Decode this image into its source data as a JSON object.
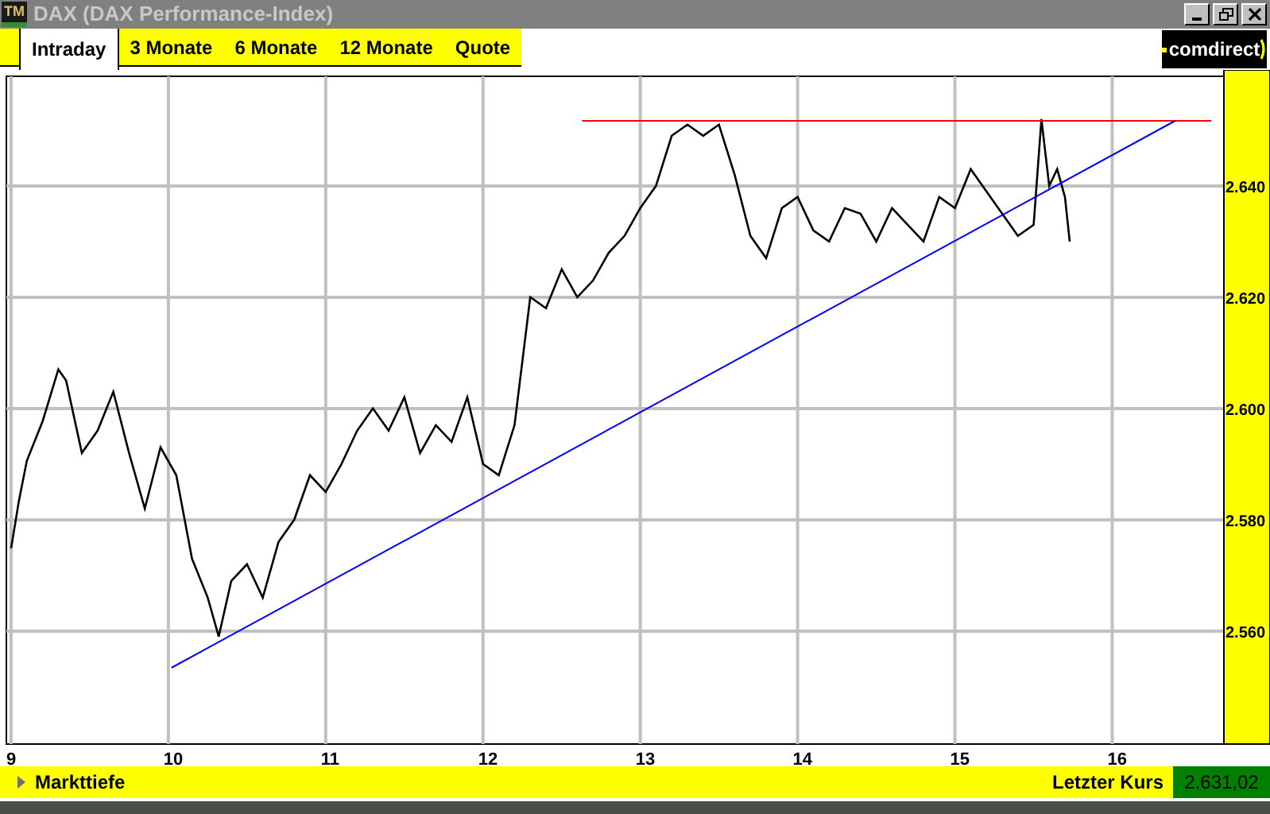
{
  "window": {
    "app_icon": "TM",
    "title": "DAX (DAX Performance-Index)"
  },
  "tabs": [
    {
      "label": "Intraday",
      "selected": true
    },
    {
      "label": "3 Monate",
      "selected": false
    },
    {
      "label": "6 Monate",
      "selected": false
    },
    {
      "label": "12 Monate",
      "selected": false
    },
    {
      "label": "Quote",
      "selected": false
    }
  ],
  "logo": {
    "text": "comdirect"
  },
  "chart": {
    "chart_data": {
      "type": "line",
      "grid": true,
      "xlim": [
        8.97,
        16.71
      ],
      "ylim": [
        2539.7,
        2659.7
      ],
      "xticks": [
        9,
        10,
        11,
        12,
        13,
        14,
        15,
        16
      ],
      "yticks": [
        {
          "value": 2560,
          "label": "2.560"
        },
        {
          "value": 2580,
          "label": "2.580"
        },
        {
          "value": 2600,
          "label": "2.600"
        },
        {
          "value": 2620,
          "label": "2.620"
        },
        {
          "value": 2640,
          "label": "2.640"
        }
      ],
      "x": [
        9.0,
        9.05,
        9.1,
        9.2,
        9.3,
        9.35,
        9.45,
        9.55,
        9.65,
        9.75,
        9.85,
        9.95,
        10.05,
        10.15,
        10.25,
        10.32,
        10.4,
        10.5,
        10.6,
        10.7,
        10.8,
        10.9,
        11.0,
        11.1,
        11.2,
        11.3,
        11.4,
        11.5,
        11.6,
        11.7,
        11.8,
        11.9,
        12.0,
        12.1,
        12.2,
        12.3,
        12.4,
        12.5,
        12.6,
        12.7,
        12.8,
        12.9,
        13.0,
        13.1,
        13.2,
        13.3,
        13.4,
        13.5,
        13.6,
        13.7,
        13.8,
        13.9,
        14.0,
        14.1,
        14.2,
        14.3,
        14.4,
        14.5,
        14.6,
        14.7,
        14.8,
        14.9,
        15.0,
        15.1,
        15.2,
        15.3,
        15.4,
        15.5,
        15.55,
        15.6,
        15.65,
        15.7,
        15.73
      ],
      "series": [
        {
          "color": "#000000",
          "values": [
            2574.9,
            2583.4,
            2590.6,
            2597.7,
            2607,
            2605,
            2592,
            2596,
            2603,
            2592,
            2582,
            2593,
            2588,
            2573,
            2566,
            2559,
            2569,
            2572,
            2566,
            2576,
            2580,
            2588,
            2585,
            2590,
            2596,
            2600,
            2596,
            2602,
            2592,
            2597,
            2594,
            2602,
            2590,
            2588,
            2597,
            2620,
            2618,
            2625,
            2620,
            2623,
            2628,
            2631,
            2636,
            2640,
            2649,
            2651,
            2649,
            2651,
            2642,
            2631,
            2627,
            2636,
            2638,
            2632,
            2630,
            2636,
            2635,
            2630,
            2636,
            2633,
            2630,
            2638,
            2636,
            2643,
            2639,
            2635,
            2631,
            2633,
            2652,
            2640,
            2643,
            2638,
            2630
          ]
        },
        {
          "color": "#ff0000",
          "x": [
            12.63,
            16.63
          ],
          "values": [
            2651.7,
            2651.7
          ]
        },
        {
          "color": "#0000ff",
          "x": [
            10.02,
            16.4
          ],
          "values": [
            2553.4,
            2651.7
          ]
        }
      ]
    }
  },
  "footer": {
    "depth_label": "Markttiefe",
    "last_price_label": "Letzter Kurs",
    "last_price": "2.631,02"
  }
}
